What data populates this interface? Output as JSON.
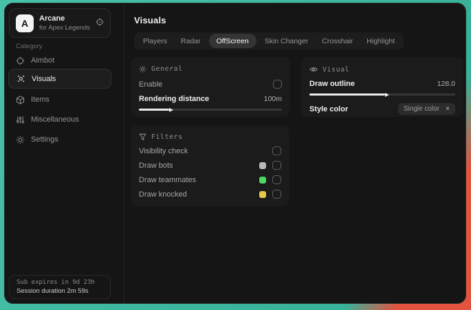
{
  "app": {
    "logo_letter": "A",
    "name": "Arcane",
    "subtitle": "for Apex Legends"
  },
  "sidebar": {
    "category_label": "Category",
    "items": [
      {
        "label": "Aimbot",
        "icon": "crosshair-icon"
      },
      {
        "label": "Visuals",
        "icon": "scan-eye-icon"
      },
      {
        "label": "Items",
        "icon": "cube-icon"
      },
      {
        "label": "Miscellaneous",
        "icon": "sliders-icon"
      },
      {
        "label": "Settings",
        "icon": "gear-icon"
      }
    ],
    "footer": {
      "line1": "Sub expires in 9d 23h",
      "line2": "Session duration 2m 59s"
    }
  },
  "main": {
    "title": "Visuals",
    "active_tab": "OffScreen",
    "tabs": [
      {
        "label": "Players"
      },
      {
        "label": "Radar"
      },
      {
        "label": "OffScreen"
      },
      {
        "label": "Skin Changer"
      },
      {
        "label": "Crosshair"
      },
      {
        "label": "Highlight"
      }
    ]
  },
  "panels": {
    "general": {
      "title": "General",
      "icon": "sun-icon",
      "enable": {
        "label": "Enable",
        "checked": false
      },
      "rendering_distance": {
        "label": "Rendering distance",
        "value": "100m",
        "percent": "21%"
      }
    },
    "visual": {
      "title": "Visual",
      "icon": "eye-icon",
      "draw_outline": {
        "label": "Draw outline",
        "value": "128.0",
        "percent": "52%"
      },
      "style_color": {
        "label": "Style color",
        "selected": "Single color",
        "clear": "×"
      }
    },
    "filters": {
      "title": "Filters",
      "icon": "funnel-icon",
      "rows": [
        {
          "label": "Visibility check",
          "checked": false
        },
        {
          "label": "Draw bots",
          "swatch": "#b9b9b9",
          "checked": false
        },
        {
          "label": "Draw teammates",
          "swatch": "#4bd964",
          "checked": false
        },
        {
          "label": "Draw knocked",
          "swatch": "#e5c84e",
          "checked": false
        }
      ]
    }
  },
  "colors": {
    "wallpaper_teal": "#3bb59c",
    "wallpaper_red": "#e2543f",
    "window_bg": "#151515",
    "panel_bg": "#1b1b1b",
    "swatch_gray": "#b9b9b9",
    "swatch_green": "#4bd964",
    "swatch_yellow": "#e5c84e"
  }
}
